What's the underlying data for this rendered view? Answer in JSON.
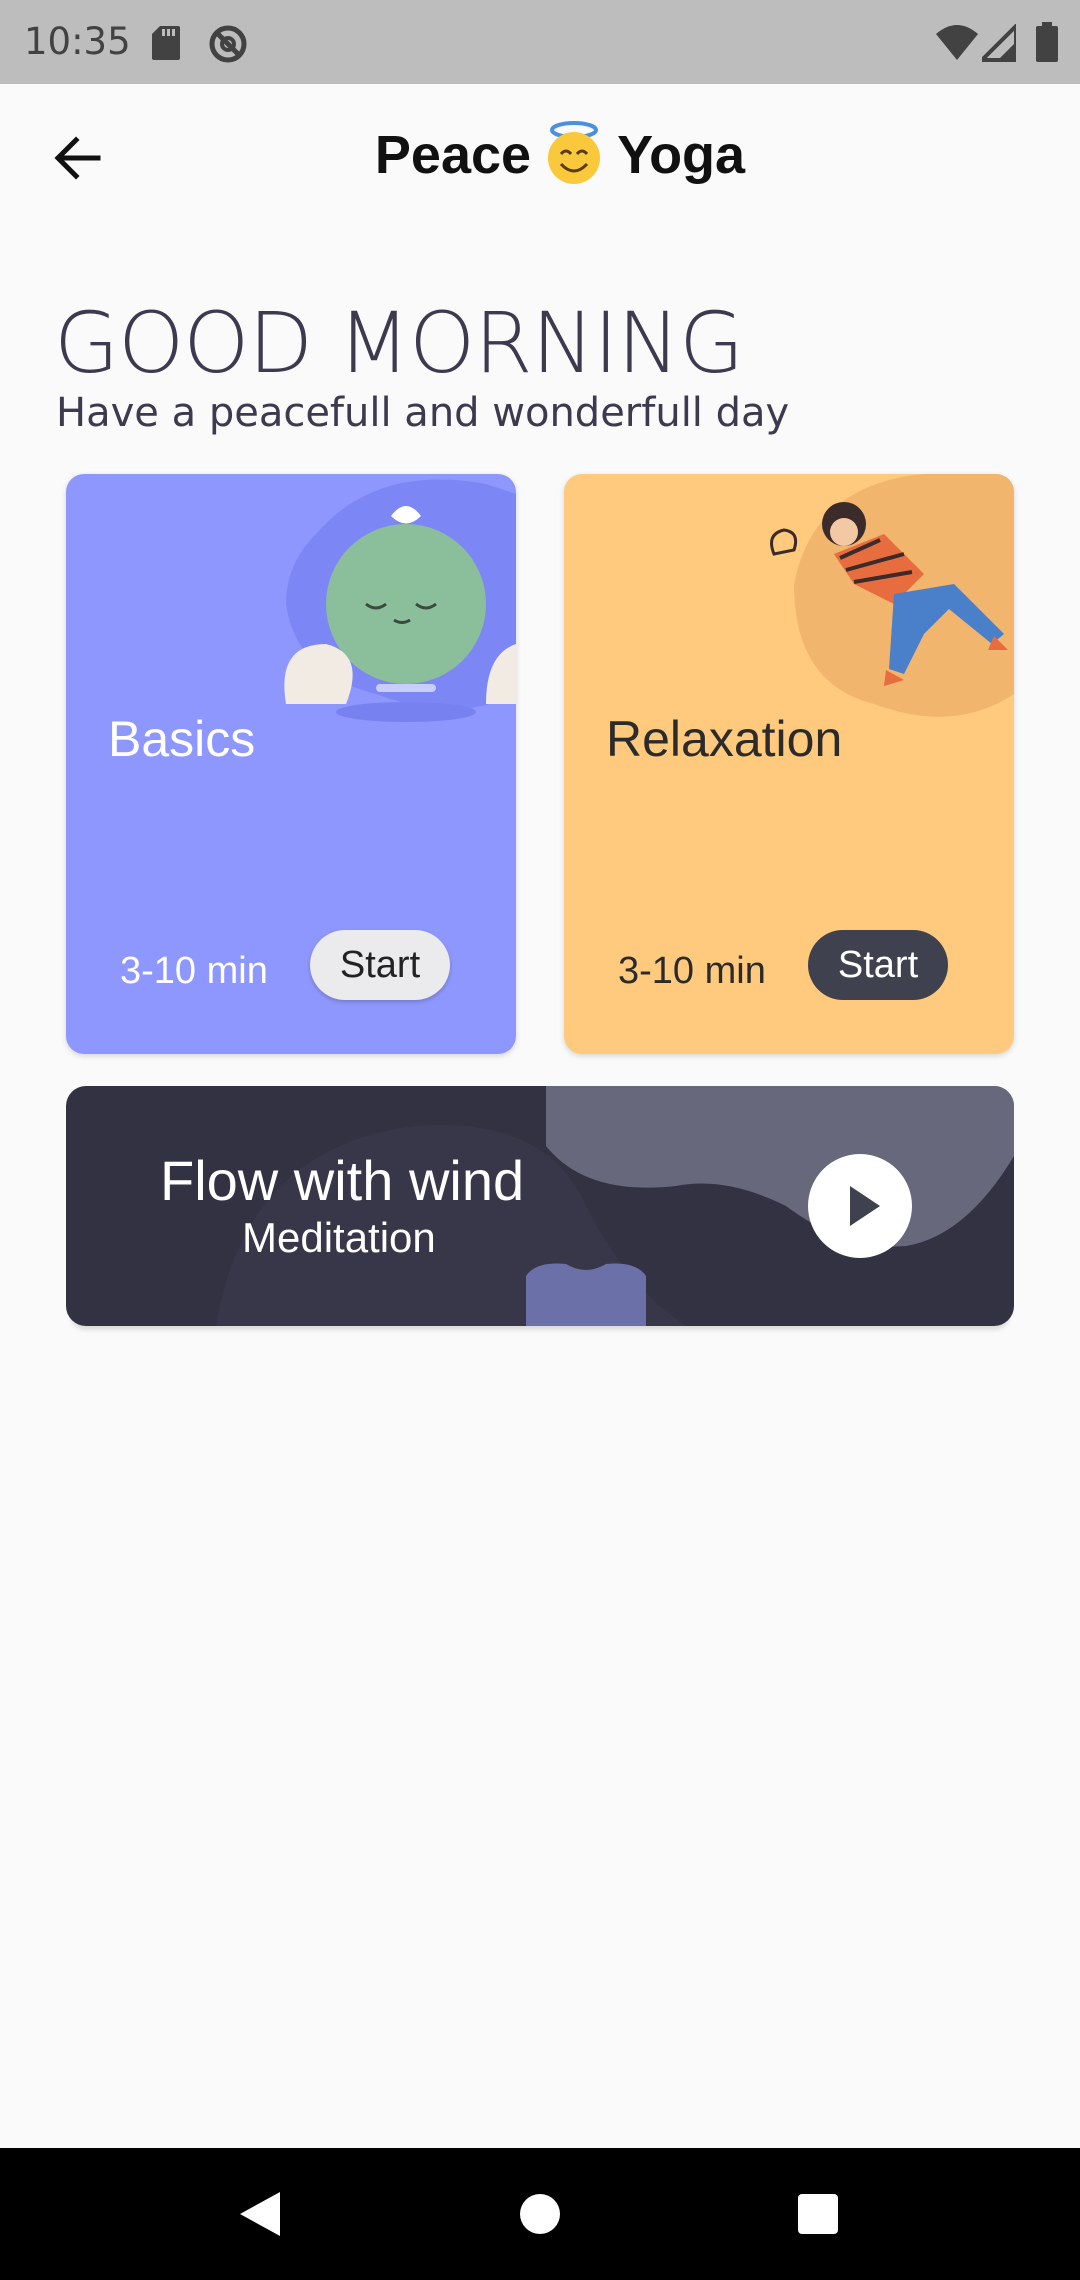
{
  "status_bar": {
    "time": "10:35",
    "icons": [
      "sd-card-icon",
      "no-disturb-icon",
      "wifi-icon",
      "signal-icon",
      "battery-icon"
    ]
  },
  "app_bar": {
    "title_left": "Peace",
    "title_right": "Yoga",
    "emoji": "smiling-halo-emoji"
  },
  "greeting": {
    "title": "GOOD MORNING",
    "subtitle": "Have a peacefull and wonderfull day"
  },
  "cards": [
    {
      "title": "Basics",
      "duration": "3-10 min",
      "button": "Start",
      "color": "#8e97fd"
    },
    {
      "title": "Relaxation",
      "duration": "3-10 min",
      "button": "Start",
      "color": "#ffc97e"
    }
  ],
  "banner": {
    "title": "Flow with wind",
    "subtitle": "Meditation",
    "color": "#333242"
  },
  "nav": {
    "icons": [
      "nav-back-icon",
      "nav-home-icon",
      "nav-recents-icon"
    ]
  }
}
